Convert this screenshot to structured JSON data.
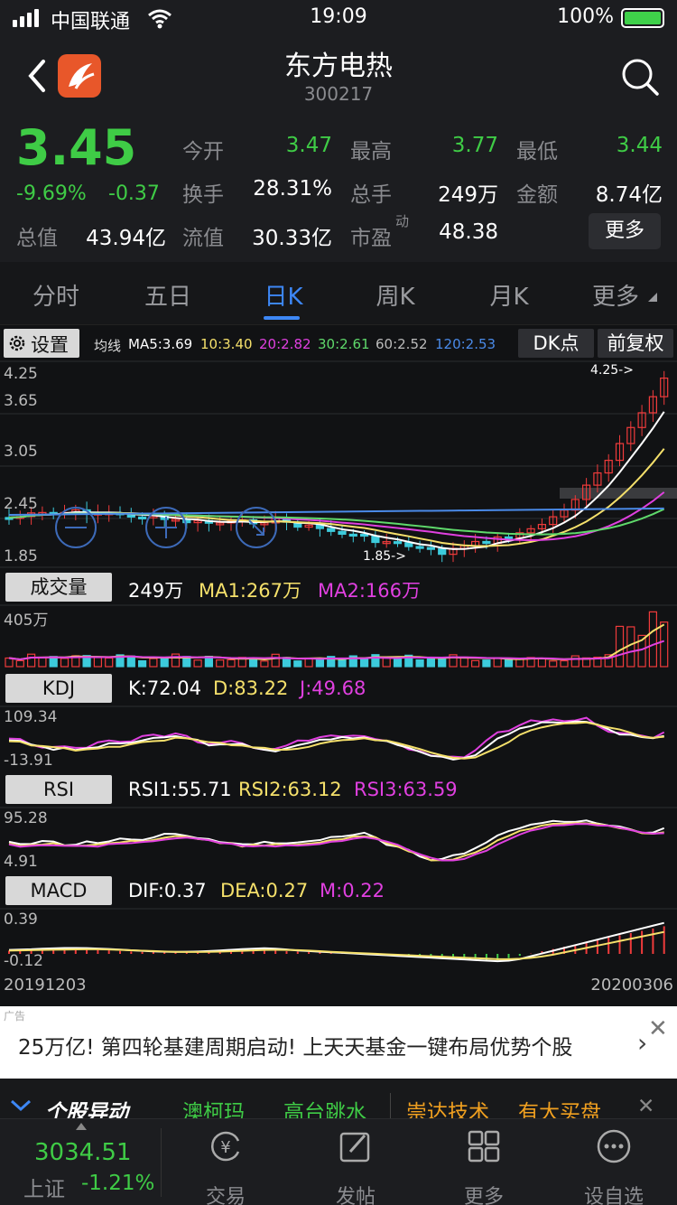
{
  "status_bar": {
    "carrier": "中国联通",
    "time": "19:09",
    "battery": "100%"
  },
  "header": {
    "name": "东方电热",
    "code": "300217"
  },
  "quote": {
    "price": "3.45",
    "change_pct": "-9.69%",
    "change": "-0.37",
    "fields": [
      {
        "label": "今开",
        "value": "3.47",
        "green": true
      },
      {
        "label": "最高",
        "value": "3.77",
        "green": true
      },
      {
        "label": "最低",
        "value": "3.44",
        "green": true
      },
      {
        "label": "换手",
        "value": "28.31%"
      },
      {
        "label": "总手",
        "value": "249万"
      },
      {
        "label": "金额",
        "value": "8.74亿"
      },
      {
        "label": "总值",
        "value": "43.94亿"
      },
      {
        "label": "流值",
        "value": "30.33亿"
      },
      {
        "label": "市盈",
        "value": "48.38",
        "sup": "动"
      }
    ],
    "more": "更多"
  },
  "tabs": [
    "分时",
    "五日",
    "日K",
    "周K",
    "月K",
    "更多"
  ],
  "active_tab": 2,
  "kline": {
    "settings": "设置",
    "ma_label": "均线",
    "ma": [
      {
        "text": "MA5:3.69",
        "color": "#ffffff"
      },
      {
        "text": "10:3.40",
        "color": "#f5e06b"
      },
      {
        "text": "20:2.82",
        "color": "#e040e0"
      },
      {
        "text": "30:2.61",
        "color": "#5fd96b"
      },
      {
        "text": "60:2.52",
        "color": "#bbbbbb"
      },
      {
        "text": "120:2.53",
        "color": "#4a8ae8"
      }
    ],
    "dk_button": "DK点",
    "adjust_button": "前复权",
    "axis": [
      "4.25",
      "3.65",
      "3.05",
      "2.45",
      "1.85"
    ],
    "high_marker": "4.25->",
    "low_marker": "1.85->"
  },
  "volume": {
    "label": "成交量",
    "value": "249万",
    "ma1": "MA1:267万",
    "ma2": "MA2:166万",
    "axis_top": "405万"
  },
  "kdj": {
    "label": "KDJ",
    "k": "K:72.04",
    "d": "D:83.22",
    "j": "J:49.68",
    "axis_top": "109.34",
    "axis_bottom": "-13.91"
  },
  "rsi": {
    "label": "RSI",
    "r1": "RSI1:55.71",
    "r2": "RSI2:63.12",
    "r3": "RSI3:63.59",
    "axis_top": "95.28",
    "axis_bottom": "4.91"
  },
  "macd": {
    "label": "MACD",
    "dif": "DIF:0.37",
    "dea": "DEA:0.27",
    "m": "M:0.22",
    "axis_top": "0.39",
    "axis_bottom": "-0.12"
  },
  "dates": {
    "start": "20191203",
    "end": "20200306"
  },
  "ad": {
    "tag": "广告",
    "text": "25万亿! 第四轮基建周期启动! 上天天基金一键布局优势个股",
    "close": "✕"
  },
  "news": {
    "title": "个股异动",
    "items": [
      "澳柯玛",
      "高台跳水",
      "崇达技术",
      "有大买盘"
    ],
    "close": "✕"
  },
  "index": {
    "value": "3034.51",
    "name": "上证",
    "change": "-1.21%"
  },
  "nav": [
    "交易",
    "发帖",
    "更多",
    "设自选"
  ],
  "colors": {
    "up": "#f03b3b",
    "down": "#3ccbdc",
    "green": "#3fcc46",
    "accent": "#3d87f5"
  }
}
